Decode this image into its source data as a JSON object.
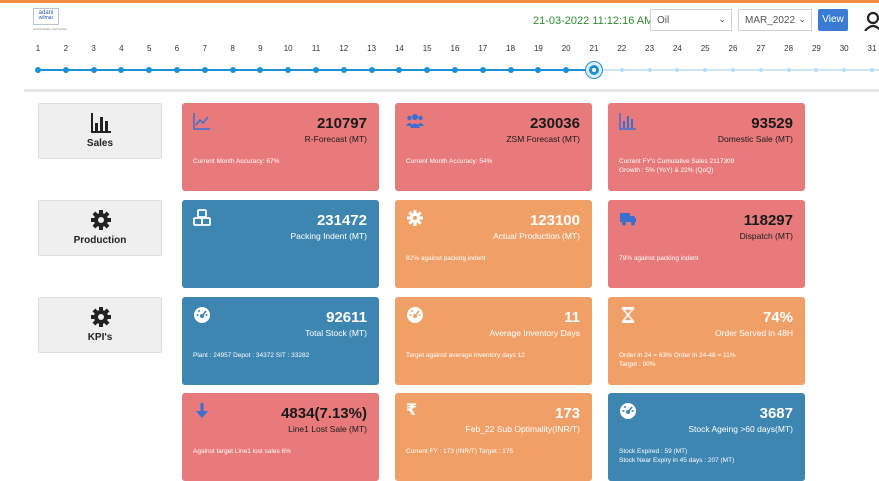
{
  "logo": {
    "line1": "adani",
    "line2": "wilmar",
    "tag": "Sustainability, partnership"
  },
  "header": {
    "datetime": "21-03-2022 11:12:16 AM",
    "product_select": "Oil",
    "month_select": "MAR_2022",
    "view_label": "View"
  },
  "timeline": {
    "days": [
      "1",
      "2",
      "3",
      "4",
      "5",
      "6",
      "7",
      "8",
      "9",
      "10",
      "11",
      "12",
      "13",
      "14",
      "15",
      "16",
      "17",
      "18",
      "19",
      "20",
      "21",
      "22",
      "23",
      "24",
      "25",
      "26",
      "27",
      "28",
      "29",
      "30",
      "31"
    ],
    "current_day": 21
  },
  "categories": {
    "sales": "Sales",
    "production": "Production",
    "kpis": "KPI's"
  },
  "cards": {
    "rforecast": {
      "value": "210797",
      "label": "R-Forecast (MT)",
      "foot": "Current Month Accuracy: 67%"
    },
    "zsm": {
      "value": "230036",
      "label": "ZSM Forecast (MT)",
      "foot": "Current Month Accuracy: 54%"
    },
    "domestic": {
      "value": "93529",
      "label": "Domestic Sale (MT)",
      "foot1": "Current FY's Cumulative Sales 2117309",
      "foot2": "Growth : 5% (YoY) & 22% (QoQ)"
    },
    "packing": {
      "value": "231472",
      "label": "Packing Indent (MT)"
    },
    "production": {
      "value": "123100",
      "label": "Actual Production (MT)",
      "foot": "82%  against packing indent"
    },
    "dispatch": {
      "value": "118297",
      "label": "Dispatch (MT)",
      "foot": "79%   against packing indent"
    },
    "stock": {
      "value": "92611",
      "label": "Total Stock (MT)",
      "foot": "Plant : 24957   Depot : 34372   SIT : 33282"
    },
    "invdays": {
      "value": "11",
      "label": "Average Inventory Days",
      "foot": "Target against average inventory days 12"
    },
    "served": {
      "value": "74%",
      "label": "Order Served in 48H",
      "foot1": "Order in 24 = 63%   Order in 24-48 = 11%",
      "foot2": "Target : 90%"
    },
    "lostsale": {
      "value": "4834(7.13%)",
      "label": "Line1 Lost Sale (MT)",
      "foot": "Against target Line1 lost sales 6%"
    },
    "suboptimality": {
      "value": "173",
      "label": "Feb_22 Sub Optimality(INR/T)",
      "foot": "Current FY :  173 (INR/T)   Target :  175"
    },
    "ageing": {
      "value": "3687",
      "label": "Stock Ageing >60 days(MT)",
      "foot1": "Stock Expired :  59 (MT)",
      "foot2": "Stock Near Expiry in 45 days : 207 (MT)"
    }
  },
  "colors": {
    "red_card": "#e97a7c",
    "blue_card": "#3d86b2",
    "orange_card": "#f0a067",
    "timeline": "#1e90d6",
    "datetime": "#2e8b2e"
  }
}
